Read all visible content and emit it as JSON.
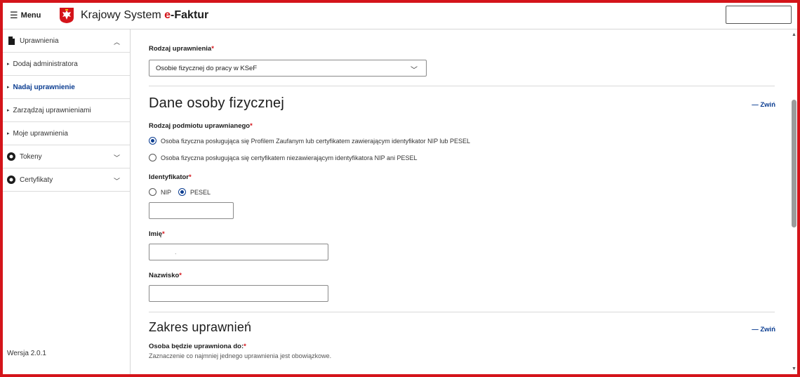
{
  "header": {
    "menu_label": "Menu",
    "brand_prefix": "Krajowy System ",
    "brand_e": "e",
    "brand_suffix": "-Faktur"
  },
  "sidebar": {
    "items": [
      {
        "label": "Uprawnienia",
        "icon": "document-icon",
        "expanded": true
      },
      {
        "label": "Dodaj administratora"
      },
      {
        "label": "Nadaj uprawnienie",
        "active": true
      },
      {
        "label": "Zarządzaj uprawnieniami"
      },
      {
        "label": "Moje uprawnienia"
      },
      {
        "label": "Tokeny",
        "icon": "token-icon",
        "expanded": false
      },
      {
        "label": "Certyfikaty",
        "icon": "certificate-icon",
        "expanded": false
      }
    ],
    "version": "Wersja 2.0.1"
  },
  "form": {
    "permission_type_label": "Rodzaj uprawnienia",
    "permission_type_value": "Osobie fizycznej do pracy w KSeF",
    "section1_title": "Dane osoby fizycznej",
    "collapse_label": "Zwiń",
    "entity_type_label": "Rodzaj podmiotu uprawnianego",
    "entity_option_1": "Osoba fizyczna posługująca się Profilem Zaufanym lub certyfikatem zawierającym identyfikator NIP lub PESEL",
    "entity_option_2": "Osoba fizyczna posługująca się certyfikatem niezawierającym identyfikatora NIP ani PESEL",
    "identifier_label": "Identyfikator",
    "id_option_nip": "NIP",
    "id_option_pesel": "PESEL",
    "identifier_value": "",
    "first_name_label": "Imię",
    "first_name_value": ".",
    "last_name_label": "Nazwisko",
    "last_name_value": "",
    "section2_title": "Zakres uprawnień",
    "scope_label": "Osoba będzie uprawniona do:",
    "scope_hint": "Zaznaczenie co najmniej jednego uprawnienia jest obowiązkowe.",
    "required_mark": "*"
  },
  "colors": {
    "accent": "#0b3d91",
    "brand_red": "#d4141a"
  }
}
